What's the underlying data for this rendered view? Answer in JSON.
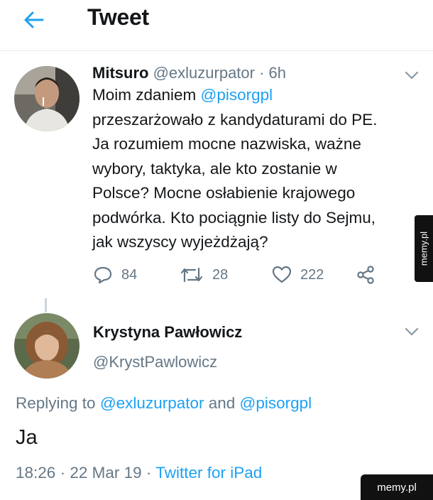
{
  "header": {
    "title": "Tweet",
    "back_icon": "arrow-left-icon"
  },
  "tweet1": {
    "name": "Mitsuro",
    "handle": "@exluzurpator",
    "dot": " · ",
    "time": "6h",
    "body": {
      "l1_prefix": "Moim zdaniem ",
      "l1_mention": "@pisorgpl",
      "l2": "przeszarżowało z kandydaturami do PE.",
      "l3": "Ja rozumiem mocne nazwiska, ważne",
      "l4": "wybory, taktyka, ale kto zostanie w",
      "l5": "Polsce? Mocne osłabienie krajowego",
      "l6": "podwórka. Kto pociągnie listy do Sejmu,",
      "l7": "jak wszyscy wyjeżdżają?"
    },
    "actions": {
      "replies": "84",
      "retweets": "28",
      "likes": "222"
    }
  },
  "tweet2": {
    "name": "Krystyna Pawłowicz",
    "handle": "@KrystPawlowicz",
    "replying_prefix": "Replying to ",
    "replying_user1": "@exluzurpator",
    "replying_and": " and ",
    "replying_user2": "@pisorgpl",
    "text": "Ja",
    "time": "18:26",
    "sep": " · ",
    "date": "22 Mar 19",
    "client": "Twitter for iPad"
  },
  "watermarks": {
    "side": "memy.pl",
    "corner": "memy.pl"
  },
  "colors": {
    "accent": "#1da1f2",
    "muted": "#657786",
    "text": "#14171a"
  }
}
